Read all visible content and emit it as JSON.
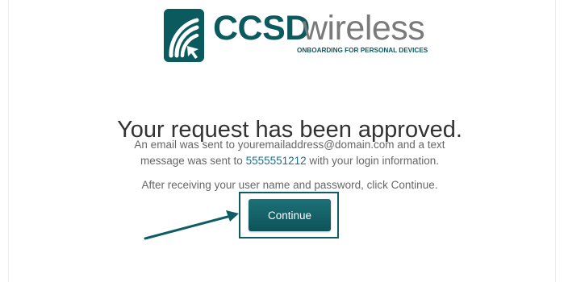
{
  "brand": {
    "name_bold": "CCSD",
    "name_light": "wireless",
    "tagline": "ONBOARDING FOR PERSONAL DEVICES",
    "icon": "wireless-signal-cursor-icon",
    "color_primary": "#0b5a5e",
    "color_secondary": "#7a7a7a"
  },
  "main": {
    "title": "Your request has been approved.",
    "message_part1": "An email was sent to youremailaddress@domain.com and a text",
    "message_part2_prefix": "message was sent to ",
    "phone_number": "5555551212",
    "message_part2_suffix": " with your login information.",
    "instruction": "After receiving your user name and password, click Continue.",
    "continue_label": "Continue"
  },
  "annotation": {
    "arrow_icon": "pointer-arrow-icon",
    "highlight_color": "#0e5d63"
  }
}
